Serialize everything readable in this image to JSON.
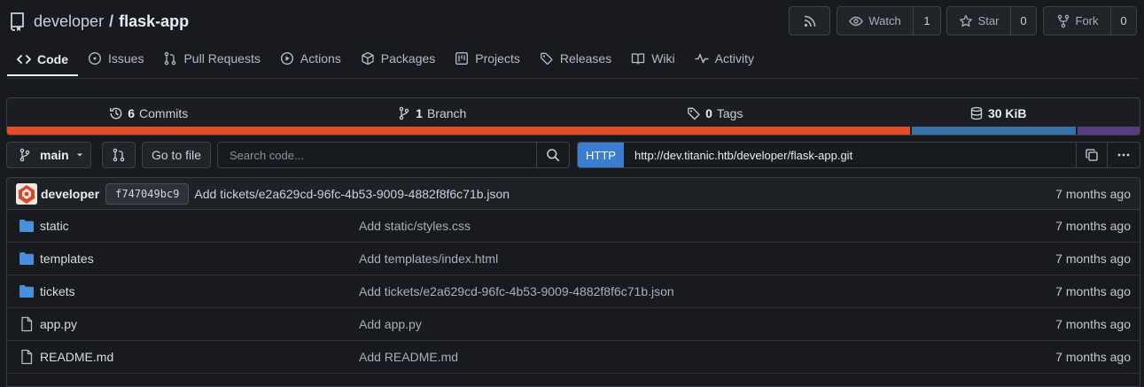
{
  "repo": {
    "owner": "developer",
    "separator": "/",
    "name": "flask-app"
  },
  "actions": {
    "watch_label": "Watch",
    "watch_count": "1",
    "star_label": "Star",
    "star_count": "0",
    "fork_label": "Fork",
    "fork_count": "0"
  },
  "tabs": [
    {
      "label": "Code",
      "icon": "code-icon"
    },
    {
      "label": "Issues",
      "icon": "issue-icon"
    },
    {
      "label": "Pull Requests",
      "icon": "pull-request-icon"
    },
    {
      "label": "Actions",
      "icon": "play-icon"
    },
    {
      "label": "Packages",
      "icon": "package-icon"
    },
    {
      "label": "Projects",
      "icon": "project-icon"
    },
    {
      "label": "Releases",
      "icon": "tag-icon"
    },
    {
      "label": "Wiki",
      "icon": "book-icon"
    },
    {
      "label": "Activity",
      "icon": "pulse-icon"
    }
  ],
  "stats": {
    "commits_count": "6",
    "commits_label": "Commits",
    "branch_count": "1",
    "branch_label": "Branch",
    "tags_count": "0",
    "tags_label": "Tags",
    "size_value": "30 KiB"
  },
  "language_bar": [
    {
      "color": "#e34c26",
      "share": 0.797
    },
    {
      "color": "#3572a5",
      "share": 0.147
    },
    {
      "color": "#563d7c",
      "share": 0.056
    }
  ],
  "toolbar": {
    "branch": "main",
    "go_to_file": "Go to file",
    "search_placeholder": "Search code...",
    "clone_protocol": "HTTP",
    "clone_url": "http://dev.titanic.htb/developer/flask-app.git"
  },
  "latest_commit": {
    "author": "developer",
    "sha": "f747049bc9",
    "message": "Add tickets/e2a629cd-96fc-4b53-9009-4882f8f6c71b.json",
    "time": "7 months ago"
  },
  "files": [
    {
      "type": "folder",
      "name": "static",
      "message": "Add static/styles.css",
      "time": "7 months ago"
    },
    {
      "type": "folder",
      "name": "templates",
      "message": "Add templates/index.html",
      "time": "7 months ago"
    },
    {
      "type": "folder",
      "name": "tickets",
      "message": "Add tickets/e2a629cd-96fc-4b53-9009-4882f8f6c71b.json",
      "time": "7 months ago"
    },
    {
      "type": "file",
      "name": "app.py",
      "message": "Add app.py",
      "time": "7 months ago"
    },
    {
      "type": "file",
      "name": "README.md",
      "message": "Add README.md",
      "time": "7 months ago"
    }
  ]
}
